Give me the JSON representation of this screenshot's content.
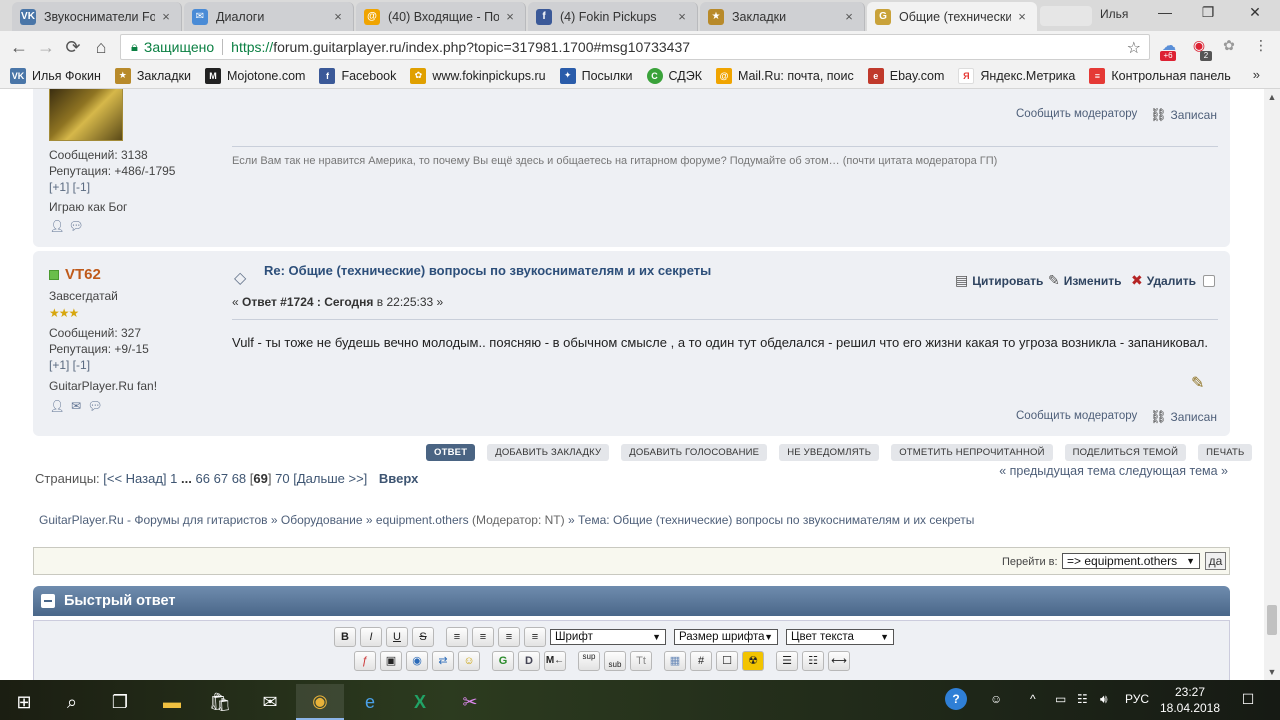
{
  "browser": {
    "tabs": [
      {
        "title": "Звукосниматели Fo",
        "icon": "vk-icon",
        "color": "#4a76a8",
        "glyph": "VK"
      },
      {
        "title": "Диалоги",
        "icon": "chat-icon",
        "color": "#4a8bd6",
        "glyph": "✉"
      },
      {
        "title": "(40) Входящие - Поч",
        "icon": "mailru-icon",
        "color": "#f0a400",
        "glyph": "@"
      },
      {
        "title": "(4) Fokin Pickups",
        "icon": "facebook-icon",
        "color": "#3b5998",
        "glyph": "f"
      },
      {
        "title": "Закладки",
        "icon": "bookmarks-icon",
        "color": "#b88a2a",
        "glyph": "★"
      },
      {
        "title": "Общие (технически",
        "icon": "forum-icon",
        "color": "#c9a23a",
        "glyph": "G"
      }
    ],
    "close_glyph": "×",
    "profile_name": "Илья",
    "window_controls": {
      "minimize": "—",
      "maximize": "❐",
      "close": "✕"
    },
    "nav": {
      "back": "←",
      "forward": "→",
      "reload": "⟳",
      "home": "⌂"
    },
    "secure_label": "Защищено",
    "url_scheme": "https://",
    "url_rest": "forum.guitarplayer.ru/index.php?topic=317981.1700#msg10733437",
    "star_glyph": "☆",
    "extension_badges": [
      "+6",
      "2"
    ],
    "bookmarks": [
      {
        "label": "Илья Фокин",
        "icon": "vk-icon",
        "color": "#4a76a8",
        "glyph": "VK"
      },
      {
        "label": "Закладки",
        "icon": "bookmarks-icon",
        "color": "#b88a2a",
        "glyph": "★"
      },
      {
        "label": "Mojotone.com",
        "icon": "mojotone-icon",
        "color": "#222222",
        "glyph": "M"
      },
      {
        "label": "Facebook",
        "icon": "facebook-icon",
        "color": "#3b5998",
        "glyph": "f"
      },
      {
        "label": "www.fokinpickups.ru",
        "icon": "flower-icon",
        "color": "#e0a000",
        "glyph": "✿"
      },
      {
        "label": "Посылки",
        "icon": "russianpost-icon",
        "color": "#2a5caa",
        "glyph": "✦"
      },
      {
        "label": "СДЭК",
        "icon": "cdek-icon",
        "color": "#3aa23a",
        "glyph": "С"
      },
      {
        "label": "Mail.Ru: почта, поис",
        "icon": "mailru-icon",
        "color": "#f0a400",
        "glyph": "@"
      },
      {
        "label": "Ebay.com",
        "icon": "ebay-icon",
        "color": "#c0392b",
        "glyph": "e"
      },
      {
        "label": "Яндекс.Метрика",
        "icon": "yandex-icon",
        "color": "#e53935",
        "glyph": "Я"
      },
      {
        "label": "Контрольная панель",
        "icon": "panel-icon",
        "color": "#e53935",
        "glyph": "≡"
      }
    ],
    "bookmarks_more": "»"
  },
  "post1": {
    "messages": "Сообщений: 3138",
    "reputation": "Репутация: +486/-1795",
    "rep_links": "[+1] [-1]",
    "personal_text": "Играю как Бог",
    "signature": "Если Вам так не нравится Америка, то почему Вы ещё здесь и общаетесь на гитарном форуме? Подумайте об этом… (почти цитата модератора ГП)",
    "report": "Сообщить модератору",
    "record": "Записан"
  },
  "post2": {
    "username": "VT62",
    "rank": "Завсегдатай",
    "stars": "★★★",
    "messages": "Сообщений: 327",
    "reputation": "Репутация: +9/-15",
    "rep_links": "[+1] [-1]",
    "personal_text": "GuitarPlayer.Ru fan!",
    "subject": "Re: Общие (технические) вопросы по звукоснимателям и их секреты",
    "meta_prefix": "« ",
    "meta_reply": "Ответ #1724 : Сегодня",
    "meta_time": " в 22:25:33 »",
    "body": "Vulf - ты тоже не будешь вечно молодым.. поясняю - в  обычном смысле , а то один тут обделался - решил что его жизни какая то угроза возникла - запаниковал.",
    "actions": {
      "quote": "Цитировать",
      "modify": "Изменить",
      "delete": "Удалить"
    },
    "report": "Сообщить модератору",
    "record": "Записан"
  },
  "topic_buttons": [
    "ОТВЕТ",
    "ДОБАВИТЬ ЗАКЛАДКУ",
    "ДОБАВИТЬ ГОЛОСОВАНИЕ",
    "НЕ УВЕДОМЛЯТЬ",
    "ОТМЕТИТЬ НЕПРОЧИТАННОЙ",
    "ПОДЕЛИТЬСЯ ТЕМОЙ",
    "ПЕЧАТЬ"
  ],
  "pagination": {
    "label": "Страницы: ",
    "back": "[<< Назад]",
    "first": "1",
    "dots": "...",
    "p66": "66",
    "p67": "67",
    "p68": "68",
    "current": "69",
    "p70": "70",
    "next": "[Дальше >>]",
    "top": "Вверх"
  },
  "prevnext": "« предыдущая тема следующая тема »",
  "breadcrumb": {
    "site": "GuitarPlayer.Ru - Форумы для гитаристов",
    "sep": "»",
    "cat": "Оборудование",
    "board": "equipment.others",
    "moderator": "(Модератор: NT)",
    "topic": "Тема: Общие (технические) вопросы по звукоснимателям и их секреты"
  },
  "jump": {
    "label": "Перейти в:",
    "selected": "=> equipment.others",
    "go": "да"
  },
  "quick_reply": {
    "title": "Быстрый ответ",
    "font_label": "Шрифт",
    "size_label": "Размер шрифта",
    "color_label": "Цвет текста",
    "row1": [
      "B",
      "I",
      "U",
      "S"
    ],
    "align": [
      "≡",
      "≡",
      "≡",
      "≡"
    ],
    "row2": [
      "ƒ",
      "▣",
      "◉",
      "⇄",
      "☺",
      "G",
      "D",
      "M←",
      "sup",
      "sub",
      "Tt",
      "▦",
      "#",
      "☐",
      "☢",
      "☰",
      "☷",
      "⟷"
    ]
  },
  "taskbar": {
    "lang": "РУС",
    "time": "23:27",
    "date": "18.04.2018"
  }
}
